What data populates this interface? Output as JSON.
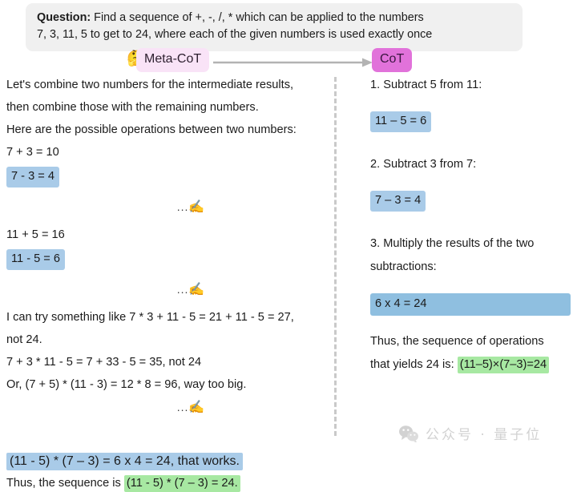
{
  "question": {
    "label": "Question:",
    "line1": " Find a sequence of +, -, /, * which can be applied to the numbers",
    "line2": "7, 3, 11, 5 to get to 24, where each of the given numbers is used exactly once"
  },
  "flow": {
    "think_icon": "🤔",
    "meta_cot_label": "Meta-CoT",
    "cot_label": "CoT",
    "arrow_color": "#b3b3b3",
    "meta_cot_bg": "#f9e3f7",
    "cot_bg": "#e172da"
  },
  "colors": {
    "highlight_blue": "#a9cbe8",
    "highlight_blue_dark": "#8fbfe0",
    "highlight_green": "#a7e8a2",
    "question_bg": "#f0f0f0",
    "divider": "#c9c9c9",
    "watermark": "#d2d2d2"
  },
  "left": {
    "l1": "Let's combine two numbers for the intermediate results,",
    "l2": "then combine those with the remaining numbers.",
    "l3": "Here are the possible operations between two numbers:",
    "l4": "7 + 3 = 10",
    "l5_highlight": "7 - 3 = 4",
    "sep1_dots": "...",
    "sep1_pen": "✍️",
    "l6": "11 + 5 = 16",
    "l7_highlight": "11 - 5 = 6",
    "sep2_dots": "...",
    "sep2_pen": "✍️",
    "l8": "I can try something like 7 * 3 + 11 - 5 = 21 + 11 - 5 = 27,",
    "l9": "not 24.",
    "l10": "7 + 3 * 11 - 5 = 7 + 33 - 5 = 35, not 24",
    "l11": "Or, (7 + 5) * (11 - 3) = 12 * 8 = 96, way too big.",
    "sep3_dots": "...",
    "sep3_pen": "✍️",
    "l12_highlight": "(11 - 5) * (7 – 3) = 6 x 4 = 24, that works.",
    "l13_prefix": "Thus, the sequence is ",
    "l13_highlight": "(11 - 5) * (7 – 3) = 24."
  },
  "right": {
    "step1": "1.  Subtract 5 from 11:",
    "step1_eq": "11 – 5 = 6",
    "step2": "2. Subtract 3 from 7:",
    "step2_eq": "7 – 3 = 4",
    "step3_a": "3. Multiply the results of the two",
    "step3_b": "subtractions:",
    "step3_eq": "6 x 4 = 24",
    "concl_a": "Thus, the sequence of operations",
    "concl_b": "that yields 24 is: ",
    "concl_highlight": "(11–5)×(7–3)=24"
  },
  "watermark": {
    "text": "公众号 · 量子位"
  }
}
